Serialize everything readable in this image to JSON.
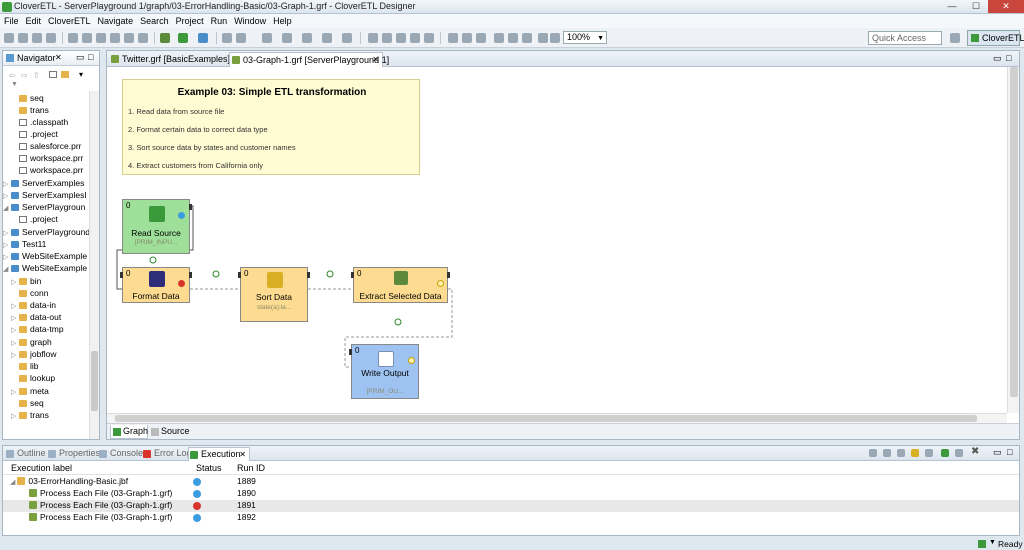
{
  "window": {
    "title": "CloverETL - ServerPlayground 1/graph/03-ErrorHandling-Basic/03-Graph-1.grf - CloverETL Designer"
  },
  "menu": [
    "File",
    "Edit",
    "CloverETL",
    "Navigate",
    "Search",
    "Project",
    "Run",
    "Window",
    "Help"
  ],
  "toolbar": {
    "zoom": "100%",
    "quick_access": "Quick Access",
    "perspective": "CloverETL"
  },
  "navigator": {
    "title": "Navigator",
    "items": [
      {
        "label": "seq",
        "kind": "folder"
      },
      {
        "label": "trans",
        "kind": "folder"
      },
      {
        "label": ".classpath",
        "kind": "file"
      },
      {
        "label": ".project",
        "kind": "file"
      },
      {
        "label": "salesforce.prr",
        "kind": "file"
      },
      {
        "label": "workspace.prr",
        "kind": "file"
      },
      {
        "label": "workspace.prr",
        "kind": "file"
      },
      {
        "label": "ServerExamples",
        "kind": "project"
      },
      {
        "label": "ServerExamplesI",
        "kind": "project"
      },
      {
        "label": "ServerPlaygroun",
        "kind": "project"
      },
      {
        "label": ".project",
        "kind": "file"
      },
      {
        "label": "ServerPlayground",
        "kind": "project"
      },
      {
        "label": "Test11",
        "kind": "project"
      },
      {
        "label": "WebSiteExample",
        "kind": "project"
      },
      {
        "label": "WebSiteExample",
        "kind": "project"
      },
      {
        "label": "bin",
        "kind": "folder"
      },
      {
        "label": "conn",
        "kind": "folder"
      },
      {
        "label": "data-in",
        "kind": "folder"
      },
      {
        "label": "data-out",
        "kind": "folder"
      },
      {
        "label": "data-tmp",
        "kind": "folder"
      },
      {
        "label": "graph",
        "kind": "folder"
      },
      {
        "label": "jobflow",
        "kind": "folder"
      },
      {
        "label": "lib",
        "kind": "folder"
      },
      {
        "label": "lookup",
        "kind": "folder"
      },
      {
        "label": "meta",
        "kind": "folder"
      },
      {
        "label": "seq",
        "kind": "folder"
      },
      {
        "label": "trans",
        "kind": "folder"
      }
    ]
  },
  "editor": {
    "tabs": [
      {
        "label": "Twitter.grf [BasicExamples]"
      },
      {
        "label": "03-Graph-1.grf [ServerPlayground 1]"
      }
    ],
    "note": {
      "title": "Example 03: Simple ETL transformation",
      "items": [
        "1. Read data from source file",
        "2. Format certain data to correct data type",
        "3. Sort source data by states and customer names",
        "4. Extract customers from California only"
      ]
    },
    "nodes": {
      "read": {
        "num": "0",
        "name": "Read Source",
        "sub": "[PRIM_INPU..."
      },
      "format": {
        "num": "0",
        "name": "Format Data"
      },
      "sort": {
        "num": "0",
        "name": "Sort Data",
        "sub": "state(a);la..."
      },
      "extract": {
        "num": "0",
        "name": "Extract Selected Data"
      },
      "write": {
        "num": "0",
        "name": "Write Output",
        "sub": "[PRIM_OU..."
      }
    },
    "bottom_tabs": [
      "Graph",
      "Source"
    ]
  },
  "bottom_panel": {
    "tabs": [
      "Outline",
      "Properties",
      "Console",
      "Error Log",
      "Execution"
    ],
    "columns": [
      "Execution label",
      "Status",
      "Run ID"
    ],
    "rows": [
      {
        "label": "03-ErrorHandling-Basic.jbf",
        "status": "ok",
        "run_id": "1889"
      },
      {
        "label": "Process Each File (03-Graph-1.grf)",
        "status": "ok",
        "run_id": "1890"
      },
      {
        "label": "Process Each File (03-Graph-1.grf)",
        "status": "error",
        "run_id": "1891"
      },
      {
        "label": "Process Each File (03-Graph-1.grf)",
        "status": "ok",
        "run_id": "1892"
      }
    ]
  },
  "status": {
    "text": "Ready"
  }
}
